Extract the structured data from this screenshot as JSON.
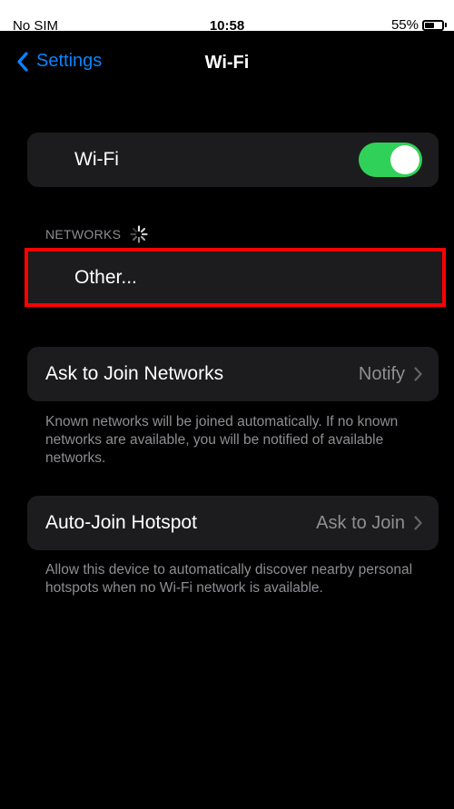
{
  "status_bar": {
    "carrier": "No SIM",
    "time": "10:58",
    "battery_percent": "55%",
    "battery_level": 0.55
  },
  "nav": {
    "back_label": "Settings",
    "title": "Wi-Fi"
  },
  "wifi": {
    "label": "Wi-Fi",
    "enabled": true,
    "toggle_color": "#30d158"
  },
  "networks": {
    "header": "NETWORKS",
    "other_label": "Other..."
  },
  "ask_to_join": {
    "label": "Ask to Join Networks",
    "value": "Notify",
    "footnote": "Known networks will be joined automatically. If no known networks are available, you will be notified of available networks."
  },
  "auto_join": {
    "label": "Auto-Join Hotspot",
    "value": "Ask to Join",
    "footnote": "Allow this device to automatically discover nearby personal hotspots when no Wi-Fi network is available."
  },
  "colors": {
    "accent": "#0a84ff",
    "background": "#000000",
    "cell": "#1c1c1e",
    "secondary_text": "#8e8e93",
    "highlight": "#ff0000"
  }
}
